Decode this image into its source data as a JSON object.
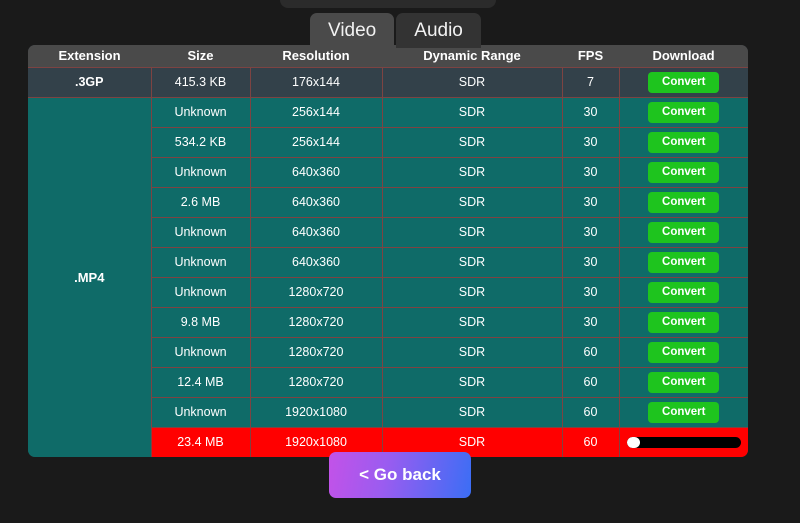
{
  "page": {
    "background_color": "#1a1a1a"
  },
  "tabs": [
    {
      "label": "Video",
      "active": true
    },
    {
      "label": "Audio",
      "active": false
    }
  ],
  "table": {
    "columns": [
      "Extension",
      "Size",
      "Resolution",
      "Dynamic Range",
      "FPS",
      "Download"
    ],
    "groups": [
      {
        "extension": ".3GP",
        "style": "slate",
        "rows": [
          {
            "size": "415.3 KB",
            "resolution": "176x144",
            "dynamic_range": "SDR",
            "fps": "7",
            "action": "Convert",
            "state": "idle"
          }
        ]
      },
      {
        "extension": ".MP4",
        "style": "teal",
        "rows": [
          {
            "size": "Unknown",
            "resolution": "256x144",
            "dynamic_range": "SDR",
            "fps": "30",
            "action": "Convert",
            "state": "idle"
          },
          {
            "size": "534.2 KB",
            "resolution": "256x144",
            "dynamic_range": "SDR",
            "fps": "30",
            "action": "Convert",
            "state": "idle"
          },
          {
            "size": "Unknown",
            "resolution": "640x360",
            "dynamic_range": "SDR",
            "fps": "30",
            "action": "Convert",
            "state": "idle"
          },
          {
            "size": "2.6 MB",
            "resolution": "640x360",
            "dynamic_range": "SDR",
            "fps": "30",
            "action": "Convert",
            "state": "idle"
          },
          {
            "size": "Unknown",
            "resolution": "640x360",
            "dynamic_range": "SDR",
            "fps": "30",
            "action": "Convert",
            "state": "idle"
          },
          {
            "size": "Unknown",
            "resolution": "640x360",
            "dynamic_range": "SDR",
            "fps": "30",
            "action": "Convert",
            "state": "idle"
          },
          {
            "size": "Unknown",
            "resolution": "1280x720",
            "dynamic_range": "SDR",
            "fps": "30",
            "action": "Convert",
            "state": "idle"
          },
          {
            "size": "9.8 MB",
            "resolution": "1280x720",
            "dynamic_range": "SDR",
            "fps": "30",
            "action": "Convert",
            "state": "idle"
          },
          {
            "size": "Unknown",
            "resolution": "1280x720",
            "dynamic_range": "SDR",
            "fps": "60",
            "action": "Convert",
            "state": "idle"
          },
          {
            "size": "12.4 MB",
            "resolution": "1280x720",
            "dynamic_range": "SDR",
            "fps": "60",
            "action": "Convert",
            "state": "idle"
          },
          {
            "size": "Unknown",
            "resolution": "1920x1080",
            "dynamic_range": "SDR",
            "fps": "60",
            "action": "Convert",
            "state": "idle"
          },
          {
            "size": "23.4 MB",
            "resolution": "1920x1080",
            "dynamic_range": "SDR",
            "fps": "60",
            "action": "",
            "state": "converting",
            "progress_percent": 12
          }
        ]
      }
    ]
  },
  "footer": {
    "go_back_label": "< Go back"
  },
  "colors": {
    "header_bg": "#4a4a4a",
    "row_slate": "#33414a",
    "row_teal": "#0f6b68",
    "row_active": "#ff0000",
    "cell_border": "#7d4342",
    "convert_green": "#1ec41e",
    "progress_track": "#000000",
    "progress_fill": "#ffffff"
  }
}
